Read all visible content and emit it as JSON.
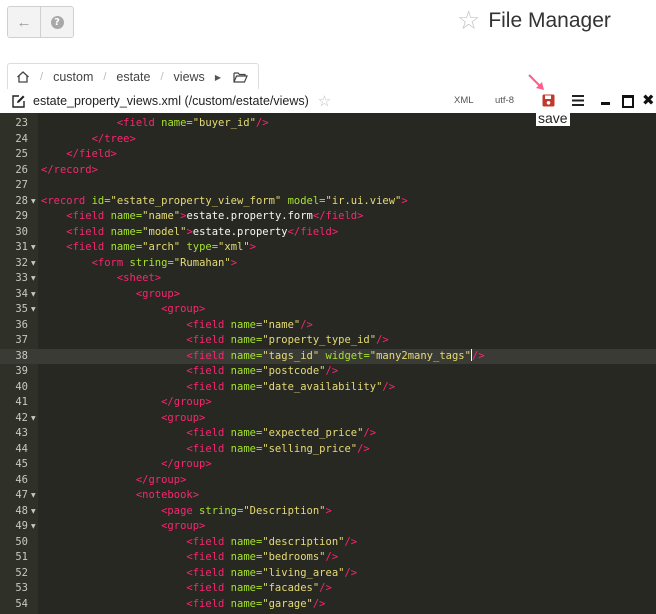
{
  "app": {
    "title": "File Manager"
  },
  "breadcrumb": {
    "items": [
      "custom",
      "estate",
      "views"
    ]
  },
  "file": {
    "name": "estate_property_views.xml (/custom/estate/views)",
    "mode": "XML",
    "encoding": "utf-8"
  },
  "annotation": {
    "caption": "save"
  },
  "colors": {
    "editor_bg": "#272822",
    "tag": "#f92672",
    "attr": "#a6e22e",
    "string": "#e6db74"
  },
  "editor": {
    "active_line": "38",
    "lines": [
      {
        "num": "23",
        "fold": false,
        "tokens": [
          {
            "t": "txt",
            "v": "            "
          },
          {
            "t": "tag",
            "v": "<field "
          },
          {
            "t": "attr",
            "v": "name="
          },
          {
            "t": "str",
            "v": "\"buyer_id\""
          },
          {
            "t": "tag",
            "v": "/>"
          }
        ]
      },
      {
        "num": "24",
        "fold": false,
        "tokens": [
          {
            "t": "txt",
            "v": "        "
          },
          {
            "t": "tag",
            "v": "</tree>"
          }
        ]
      },
      {
        "num": "25",
        "fold": false,
        "tokens": [
          {
            "t": "txt",
            "v": "    "
          },
          {
            "t": "tag",
            "v": "</field>"
          }
        ]
      },
      {
        "num": "26",
        "fold": false,
        "tokens": [
          {
            "t": "tag",
            "v": "</record>"
          }
        ]
      },
      {
        "num": "27",
        "fold": false,
        "tokens": []
      },
      {
        "num": "28",
        "fold": true,
        "tokens": [
          {
            "t": "tag",
            "v": "<record "
          },
          {
            "t": "attr",
            "v": "id="
          },
          {
            "t": "str",
            "v": "\"estate_property_view_form\""
          },
          {
            "t": "txt",
            "v": " "
          },
          {
            "t": "attr",
            "v": "model="
          },
          {
            "t": "str",
            "v": "\"ir.ui.view\""
          },
          {
            "t": "tag",
            "v": ">"
          }
        ]
      },
      {
        "num": "29",
        "fold": false,
        "tokens": [
          {
            "t": "txt",
            "v": "    "
          },
          {
            "t": "tag",
            "v": "<field "
          },
          {
            "t": "attr",
            "v": "name="
          },
          {
            "t": "str",
            "v": "\"name\""
          },
          {
            "t": "tag",
            "v": ">"
          },
          {
            "t": "txt",
            "v": "estate.property.form"
          },
          {
            "t": "tag",
            "v": "</field>"
          }
        ]
      },
      {
        "num": "30",
        "fold": false,
        "tokens": [
          {
            "t": "txt",
            "v": "    "
          },
          {
            "t": "tag",
            "v": "<field "
          },
          {
            "t": "attr",
            "v": "name="
          },
          {
            "t": "str",
            "v": "\"model\""
          },
          {
            "t": "tag",
            "v": ">"
          },
          {
            "t": "txt",
            "v": "estate.property"
          },
          {
            "t": "tag",
            "v": "</field>"
          }
        ]
      },
      {
        "num": "31",
        "fold": true,
        "tokens": [
          {
            "t": "txt",
            "v": "    "
          },
          {
            "t": "tag",
            "v": "<field "
          },
          {
            "t": "attr",
            "v": "name="
          },
          {
            "t": "str",
            "v": "\"arch\""
          },
          {
            "t": "txt",
            "v": " "
          },
          {
            "t": "attr",
            "v": "type="
          },
          {
            "t": "str",
            "v": "\"xml\""
          },
          {
            "t": "tag",
            "v": ">"
          }
        ]
      },
      {
        "num": "32",
        "fold": true,
        "tokens": [
          {
            "t": "txt",
            "v": "        "
          },
          {
            "t": "tag",
            "v": "<form "
          },
          {
            "t": "attr",
            "v": "string="
          },
          {
            "t": "str",
            "v": "\"Rumahan\""
          },
          {
            "t": "tag",
            "v": ">"
          }
        ]
      },
      {
        "num": "33",
        "fold": true,
        "tokens": [
          {
            "t": "txt",
            "v": "            "
          },
          {
            "t": "tag",
            "v": "<sheet>"
          }
        ]
      },
      {
        "num": "34",
        "fold": true,
        "tokens": [
          {
            "t": "txt",
            "v": "               "
          },
          {
            "t": "tag",
            "v": "<group>"
          }
        ]
      },
      {
        "num": "35",
        "fold": true,
        "tokens": [
          {
            "t": "txt",
            "v": "                   "
          },
          {
            "t": "tag",
            "v": "<group>"
          }
        ]
      },
      {
        "num": "36",
        "fold": false,
        "tokens": [
          {
            "t": "txt",
            "v": "                       "
          },
          {
            "t": "tag",
            "v": "<field "
          },
          {
            "t": "attr",
            "v": "name="
          },
          {
            "t": "str",
            "v": "\"name\""
          },
          {
            "t": "tag",
            "v": "/>"
          }
        ]
      },
      {
        "num": "37",
        "fold": false,
        "tokens": [
          {
            "t": "txt",
            "v": "                       "
          },
          {
            "t": "tag",
            "v": "<field "
          },
          {
            "t": "attr",
            "v": "name="
          },
          {
            "t": "str",
            "v": "\"property_type_id\""
          },
          {
            "t": "tag",
            "v": "/>"
          }
        ]
      },
      {
        "num": "38",
        "fold": false,
        "cursor": true,
        "tokens": [
          {
            "t": "txt",
            "v": "                       "
          },
          {
            "t": "tag",
            "v": "<field "
          },
          {
            "t": "attr",
            "v": "name="
          },
          {
            "t": "str",
            "v": "\"tags_id\""
          },
          {
            "t": "txt",
            "v": " "
          },
          {
            "t": "attr",
            "v": "widget="
          },
          {
            "t": "str",
            "v": "\"many2many_tags\""
          },
          {
            "t": "cursor",
            "v": ""
          },
          {
            "t": "tag",
            "v": "/>"
          }
        ]
      },
      {
        "num": "39",
        "fold": false,
        "tokens": [
          {
            "t": "txt",
            "v": "                       "
          },
          {
            "t": "tag",
            "v": "<field "
          },
          {
            "t": "attr",
            "v": "name="
          },
          {
            "t": "str",
            "v": "\"postcode\""
          },
          {
            "t": "tag",
            "v": "/>"
          }
        ]
      },
      {
        "num": "40",
        "fold": false,
        "tokens": [
          {
            "t": "txt",
            "v": "                       "
          },
          {
            "t": "tag",
            "v": "<field "
          },
          {
            "t": "attr",
            "v": "name="
          },
          {
            "t": "str",
            "v": "\"date_availability\""
          },
          {
            "t": "tag",
            "v": "/>"
          }
        ]
      },
      {
        "num": "41",
        "fold": false,
        "tokens": [
          {
            "t": "txt",
            "v": "                   "
          },
          {
            "t": "tag",
            "v": "</group>"
          }
        ]
      },
      {
        "num": "42",
        "fold": true,
        "tokens": [
          {
            "t": "txt",
            "v": "                   "
          },
          {
            "t": "tag",
            "v": "<group>"
          }
        ]
      },
      {
        "num": "43",
        "fold": false,
        "tokens": [
          {
            "t": "txt",
            "v": "                       "
          },
          {
            "t": "tag",
            "v": "<field "
          },
          {
            "t": "attr",
            "v": "name="
          },
          {
            "t": "str",
            "v": "\"expected_price\""
          },
          {
            "t": "tag",
            "v": "/>"
          }
        ]
      },
      {
        "num": "44",
        "fold": false,
        "tokens": [
          {
            "t": "txt",
            "v": "                       "
          },
          {
            "t": "tag",
            "v": "<field "
          },
          {
            "t": "attr",
            "v": "name="
          },
          {
            "t": "str",
            "v": "\"selling_price\""
          },
          {
            "t": "tag",
            "v": "/>"
          }
        ]
      },
      {
        "num": "45",
        "fold": false,
        "tokens": [
          {
            "t": "txt",
            "v": "                   "
          },
          {
            "t": "tag",
            "v": "</group>"
          }
        ]
      },
      {
        "num": "46",
        "fold": false,
        "tokens": [
          {
            "t": "txt",
            "v": "               "
          },
          {
            "t": "tag",
            "v": "</group>"
          }
        ]
      },
      {
        "num": "47",
        "fold": true,
        "tokens": [
          {
            "t": "txt",
            "v": "               "
          },
          {
            "t": "tag",
            "v": "<notebook>"
          }
        ]
      },
      {
        "num": "48",
        "fold": true,
        "tokens": [
          {
            "t": "txt",
            "v": "                   "
          },
          {
            "t": "tag",
            "v": "<page "
          },
          {
            "t": "attr",
            "v": "string="
          },
          {
            "t": "str",
            "v": "\"Description\""
          },
          {
            "t": "tag",
            "v": ">"
          }
        ]
      },
      {
        "num": "49",
        "fold": true,
        "tokens": [
          {
            "t": "txt",
            "v": "                   "
          },
          {
            "t": "tag",
            "v": "<group>"
          }
        ]
      },
      {
        "num": "50",
        "fold": false,
        "tokens": [
          {
            "t": "txt",
            "v": "                       "
          },
          {
            "t": "tag",
            "v": "<field "
          },
          {
            "t": "attr",
            "v": "name="
          },
          {
            "t": "str",
            "v": "\"description\""
          },
          {
            "t": "tag",
            "v": "/>"
          }
        ]
      },
      {
        "num": "51",
        "fold": false,
        "tokens": [
          {
            "t": "txt",
            "v": "                       "
          },
          {
            "t": "tag",
            "v": "<field "
          },
          {
            "t": "attr",
            "v": "name="
          },
          {
            "t": "str",
            "v": "\"bedrooms\""
          },
          {
            "t": "tag",
            "v": "/>"
          }
        ]
      },
      {
        "num": "52",
        "fold": false,
        "tokens": [
          {
            "t": "txt",
            "v": "                       "
          },
          {
            "t": "tag",
            "v": "<field "
          },
          {
            "t": "attr",
            "v": "name="
          },
          {
            "t": "str",
            "v": "\"living_area\""
          },
          {
            "t": "tag",
            "v": "/>"
          }
        ]
      },
      {
        "num": "53",
        "fold": false,
        "tokens": [
          {
            "t": "txt",
            "v": "                       "
          },
          {
            "t": "tag",
            "v": "<field "
          },
          {
            "t": "attr",
            "v": "name="
          },
          {
            "t": "str",
            "v": "\"facades\""
          },
          {
            "t": "tag",
            "v": "/>"
          }
        ]
      },
      {
        "num": "54",
        "fold": false,
        "tokens": [
          {
            "t": "txt",
            "v": "                       "
          },
          {
            "t": "tag",
            "v": "<field "
          },
          {
            "t": "attr",
            "v": "name="
          },
          {
            "t": "str",
            "v": "\"garage\""
          },
          {
            "t": "tag",
            "v": "/>"
          }
        ]
      }
    ]
  }
}
